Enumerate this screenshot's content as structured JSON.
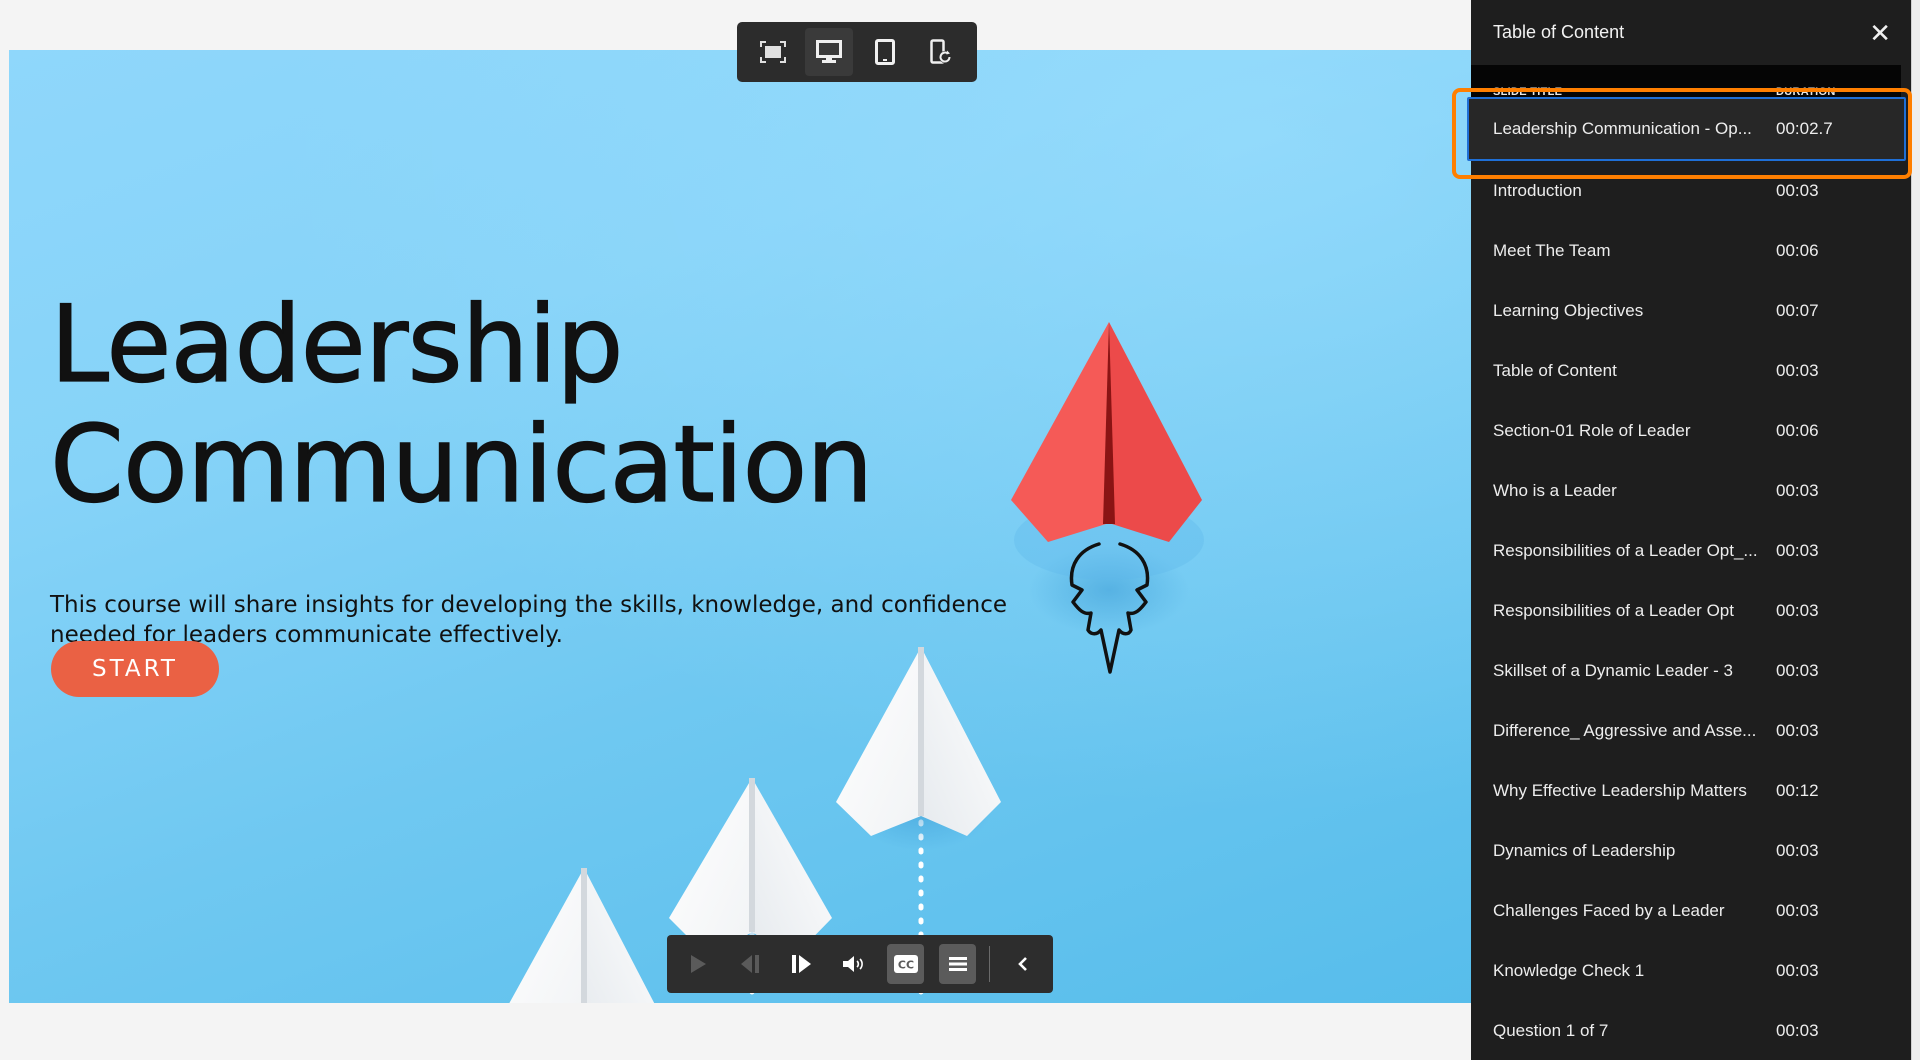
{
  "slide": {
    "title_line1": "Leadership",
    "title_line2": "Communication",
    "subtitle_line1": "This course will share insights for developing the skills, knowledge, and confidence",
    "subtitle_line2": "needed for leaders communicate effectively.",
    "start_label": "START",
    "colors": {
      "start_button": "#ea6144",
      "background": "#6fc8f1",
      "red_plane": "#f25656"
    }
  },
  "view_toolbar": {
    "buttons": [
      {
        "icon": "fit-to-screen-icon",
        "active": false
      },
      {
        "icon": "desktop-icon",
        "active": true
      },
      {
        "icon": "tablet-icon",
        "active": false
      },
      {
        "icon": "rotate-device-icon",
        "active": false
      }
    ]
  },
  "playbar": {
    "buttons": [
      {
        "icon": "play-icon",
        "enabled": false
      },
      {
        "icon": "previous-icon",
        "enabled": false
      },
      {
        "icon": "next-icon",
        "enabled": true
      },
      {
        "icon": "volume-icon",
        "enabled": true
      },
      {
        "icon": "closed-captions-icon",
        "toggled": true,
        "label": "CC"
      },
      {
        "icon": "table-of-contents-icon",
        "toggled": true
      },
      {
        "icon": "collapse-chevron-icon",
        "enabled": true
      }
    ]
  },
  "toc": {
    "title": "Table of Content",
    "close_icon": "close-icon",
    "columns": {
      "title": "SLIDE TITLE",
      "duration": "DURATION"
    },
    "current_index": 0,
    "rows": [
      {
        "title": "Leadership Communication - Op...",
        "duration": "00:02.7"
      },
      {
        "title": "Introduction",
        "duration": "00:03"
      },
      {
        "title": "Meet  The Team",
        "duration": "00:06"
      },
      {
        "title": "Learning Objectives",
        "duration": "00:07"
      },
      {
        "title": "Table of Content",
        "duration": "00:03"
      },
      {
        "title": "Section-01 Role of Leader",
        "duration": "00:06"
      },
      {
        "title": "Who is a Leader",
        "duration": "00:03"
      },
      {
        "title": "Responsibilities of a Leader Opt_...",
        "duration": "00:03"
      },
      {
        "title": "Responsibilities of a Leader Opt",
        "duration": "00:03"
      },
      {
        "title": "Skillset of a Dynamic Leader - 3",
        "duration": "00:03"
      },
      {
        "title": "Difference_ Aggressive and Asse...",
        "duration": "00:03"
      },
      {
        "title": "Why Effective Leadership Matters",
        "duration": "00:12"
      },
      {
        "title": "Dynamics of Leadership",
        "duration": "00:03"
      },
      {
        "title": "Challenges Faced by a Leader",
        "duration": "00:03"
      },
      {
        "title": "Knowledge Check 1",
        "duration": "00:03"
      },
      {
        "title": "Question 1 of 7",
        "duration": "00:03"
      }
    ],
    "highlight_color": "#ff7f00",
    "selection_color": "#1f6fd6"
  }
}
